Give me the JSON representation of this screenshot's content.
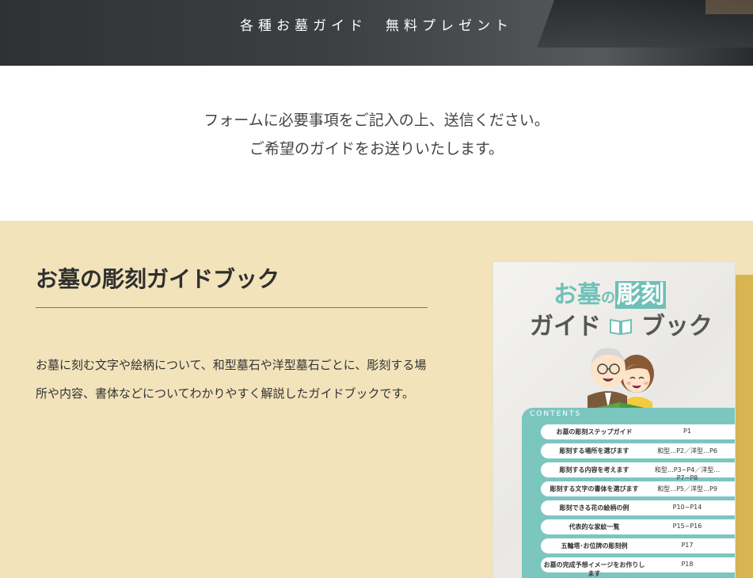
{
  "hero": {
    "title": "各種お墓ガイド　無料プレゼント"
  },
  "intro": {
    "line1": "フォームに必要事項をご記入の上、送信ください。",
    "line2": "ご希望のガイドをお送りいたします。"
  },
  "guide": {
    "title": "お墓の彫刻ガイドブック",
    "description": "お墓に刻む文字や絵柄について、和型墓石や洋型墓石ごとに、彫刻する場所や内容、書体などについてわかりやすく解説したガイドブックです。",
    "cover": {
      "title_part1": "お墓",
      "title_no": "の",
      "title_part2": "彫刻",
      "title_part3": "ガイド",
      "title_part4": "ブック",
      "contents_label": "CONTENTS",
      "toc": [
        {
          "title": "お墓の彫刻ステップガイド",
          "page": "P1"
        },
        {
          "title": "彫刻する場所を選びます",
          "page": "和型…P2／洋型…P6"
        },
        {
          "title": "彫刻する内容を考えます",
          "page": "和型…P3~P4／洋型…P7~P8"
        },
        {
          "title": "彫刻する文字の書体を選びます",
          "page": "和型…P5／洋型…P9"
        },
        {
          "title": "彫刻できる花の絵柄の例",
          "page": "P10~P14"
        },
        {
          "title": "代表的な家紋一覧",
          "page": "P15~P16"
        },
        {
          "title": "五輪塔･お位牌の彫刻例",
          "page": "P17"
        },
        {
          "title": "お墓の完成予想イメージをお作りします",
          "page": "P18"
        }
      ]
    }
  }
}
